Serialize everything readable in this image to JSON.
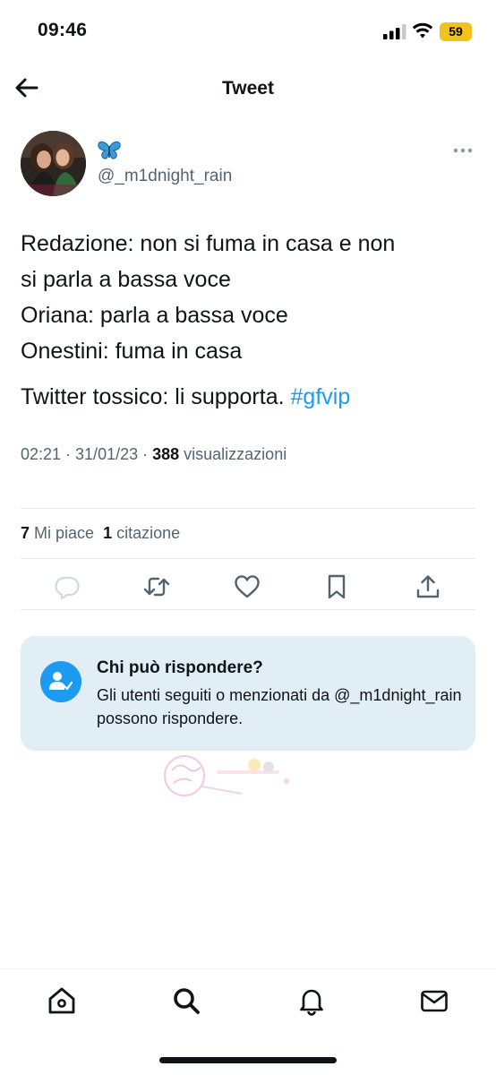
{
  "status_bar": {
    "time": "09:46",
    "battery": "59",
    "battery_color": "#f2c21b"
  },
  "header": {
    "title": "Tweet"
  },
  "author": {
    "display_name_icon": "butterfly-emoji",
    "handle": "@_m1dnight_rain"
  },
  "tweet": {
    "lines": [
      "Redazione: non si fuma in casa e non",
      "si parla a bassa voce",
      "Oriana: parla a bassa voce",
      "Onestini: fuma in casa"
    ],
    "final_text": "Twitter tossico: li supporta.",
    "hashtag": "#gfvip"
  },
  "meta": {
    "time_date": "02:21 · 31/01/23 · ",
    "views_count": "388",
    "views_label": " visualizzazioni"
  },
  "stats": {
    "likes_count": "7",
    "likes_label": " Mi piace",
    "quotes_count": "1",
    "quotes_label": " citazione"
  },
  "actions": [
    "reply-icon",
    "retweet-icon",
    "like-icon",
    "bookmark-icon",
    "share-icon"
  ],
  "reply_restriction": {
    "title": "Chi può rispondere?",
    "description": "Gli utenti seguiti o menzionati da @_m1dnight_rain possono rispondere."
  },
  "tab_bar": [
    "home-icon",
    "search-icon",
    "notifications-icon",
    "messages-icon"
  ],
  "colors": {
    "accent": "#1d9bf0",
    "text": "#0f1419",
    "secondary": "#536471",
    "card_bg": "#e1eef6"
  }
}
